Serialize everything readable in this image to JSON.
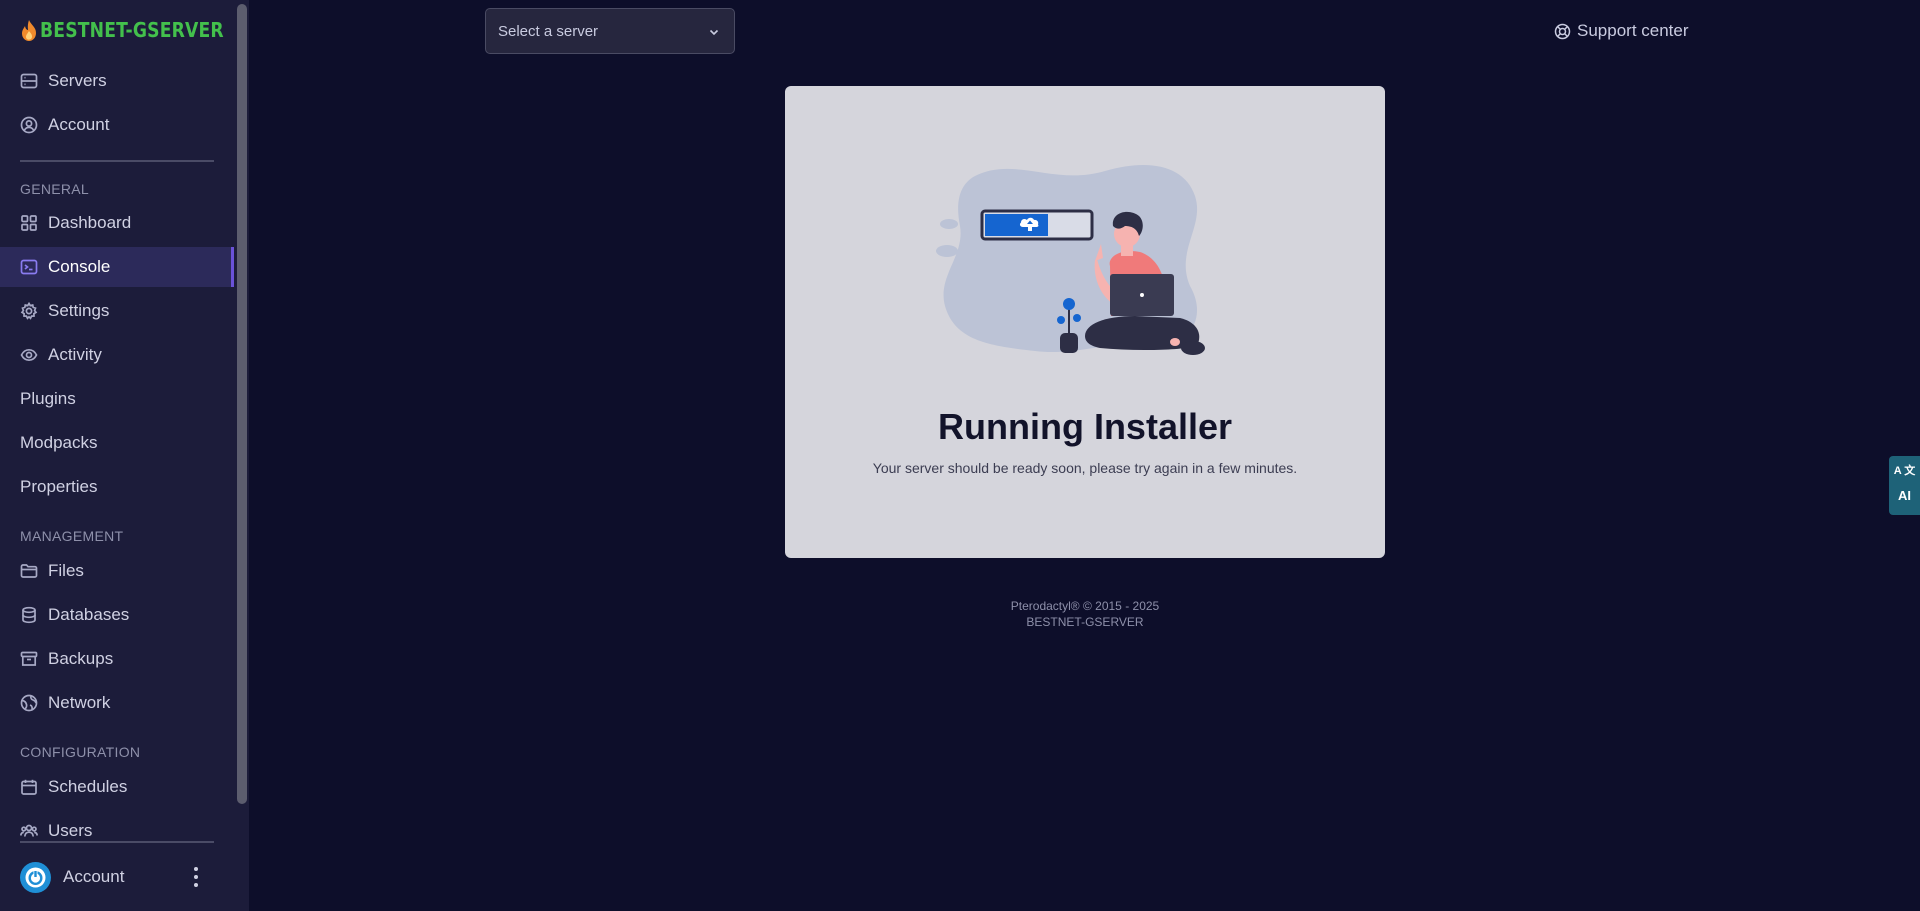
{
  "brand": {
    "name": "BESTNET-GSERVER"
  },
  "sidebar": {
    "top_items": [
      {
        "label": "Servers",
        "icon": "server-icon"
      },
      {
        "label": "Account",
        "icon": "user-circle-icon"
      }
    ],
    "sections": {
      "general": "GENERAL",
      "management": "MANAGEMENT",
      "configuration": "CONFIGURATION"
    },
    "general_items": [
      {
        "label": "Dashboard",
        "icon": "grid-icon"
      },
      {
        "label": "Console",
        "icon": "terminal-icon",
        "active": true
      },
      {
        "label": "Settings",
        "icon": "gear-icon"
      },
      {
        "label": "Activity",
        "icon": "eye-icon"
      },
      {
        "label": "Plugins"
      },
      {
        "label": "Modpacks"
      },
      {
        "label": "Properties"
      }
    ],
    "management_items": [
      {
        "label": "Files",
        "icon": "folder-icon"
      },
      {
        "label": "Databases",
        "icon": "database-icon"
      },
      {
        "label": "Backups",
        "icon": "archive-icon"
      },
      {
        "label": "Network",
        "icon": "globe-icon"
      }
    ],
    "configuration_items": [
      {
        "label": "Schedules",
        "icon": "calendar-icon"
      },
      {
        "label": "Users",
        "icon": "users-icon"
      }
    ],
    "footer": {
      "label": "Account"
    }
  },
  "header": {
    "server_select_placeholder": "Select a server",
    "support_label": "Support center"
  },
  "card": {
    "title": "Running Installer",
    "subtitle": "Your server should be ready soon, please try again in a few minutes."
  },
  "footer": {
    "line1": "Pterodactyl® © 2015 - 2025",
    "line2": "BESTNET-GSERVER"
  },
  "translate_widget": {
    "top": "A 文",
    "ai": "AI"
  },
  "colors": {
    "background": "#0d0e2a",
    "sidebar": "#1c1c3a",
    "active_accent": "#6a52d8",
    "brand_green": "#43c04c",
    "card": "#d5d5dc"
  }
}
